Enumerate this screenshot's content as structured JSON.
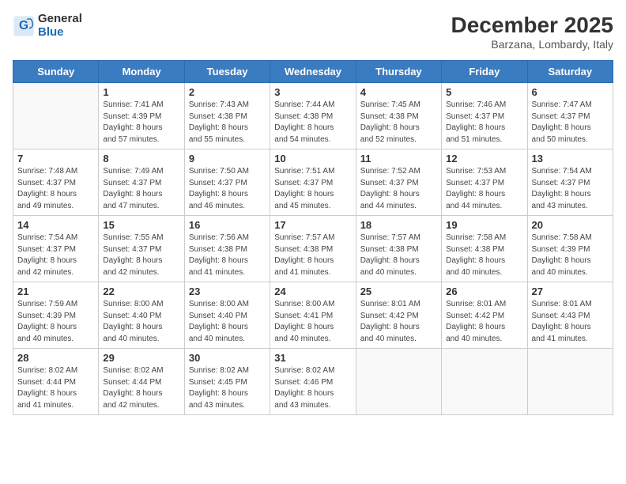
{
  "header": {
    "logo_general": "General",
    "logo_blue": "Blue",
    "month_title": "December 2025",
    "location": "Barzana, Lombardy, Italy"
  },
  "days_of_week": [
    "Sunday",
    "Monday",
    "Tuesday",
    "Wednesday",
    "Thursday",
    "Friday",
    "Saturday"
  ],
  "weeks": [
    [
      {
        "day": "",
        "info": ""
      },
      {
        "day": "1",
        "info": "Sunrise: 7:41 AM\nSunset: 4:39 PM\nDaylight: 8 hours\nand 57 minutes."
      },
      {
        "day": "2",
        "info": "Sunrise: 7:43 AM\nSunset: 4:38 PM\nDaylight: 8 hours\nand 55 minutes."
      },
      {
        "day": "3",
        "info": "Sunrise: 7:44 AM\nSunset: 4:38 PM\nDaylight: 8 hours\nand 54 minutes."
      },
      {
        "day": "4",
        "info": "Sunrise: 7:45 AM\nSunset: 4:38 PM\nDaylight: 8 hours\nand 52 minutes."
      },
      {
        "day": "5",
        "info": "Sunrise: 7:46 AM\nSunset: 4:37 PM\nDaylight: 8 hours\nand 51 minutes."
      },
      {
        "day": "6",
        "info": "Sunrise: 7:47 AM\nSunset: 4:37 PM\nDaylight: 8 hours\nand 50 minutes."
      }
    ],
    [
      {
        "day": "7",
        "info": "Sunrise: 7:48 AM\nSunset: 4:37 PM\nDaylight: 8 hours\nand 49 minutes."
      },
      {
        "day": "8",
        "info": "Sunrise: 7:49 AM\nSunset: 4:37 PM\nDaylight: 8 hours\nand 47 minutes."
      },
      {
        "day": "9",
        "info": "Sunrise: 7:50 AM\nSunset: 4:37 PM\nDaylight: 8 hours\nand 46 minutes."
      },
      {
        "day": "10",
        "info": "Sunrise: 7:51 AM\nSunset: 4:37 PM\nDaylight: 8 hours\nand 45 minutes."
      },
      {
        "day": "11",
        "info": "Sunrise: 7:52 AM\nSunset: 4:37 PM\nDaylight: 8 hours\nand 44 minutes."
      },
      {
        "day": "12",
        "info": "Sunrise: 7:53 AM\nSunset: 4:37 PM\nDaylight: 8 hours\nand 44 minutes."
      },
      {
        "day": "13",
        "info": "Sunrise: 7:54 AM\nSunset: 4:37 PM\nDaylight: 8 hours\nand 43 minutes."
      }
    ],
    [
      {
        "day": "14",
        "info": "Sunrise: 7:54 AM\nSunset: 4:37 PM\nDaylight: 8 hours\nand 42 minutes."
      },
      {
        "day": "15",
        "info": "Sunrise: 7:55 AM\nSunset: 4:37 PM\nDaylight: 8 hours\nand 42 minutes."
      },
      {
        "day": "16",
        "info": "Sunrise: 7:56 AM\nSunset: 4:38 PM\nDaylight: 8 hours\nand 41 minutes."
      },
      {
        "day": "17",
        "info": "Sunrise: 7:57 AM\nSunset: 4:38 PM\nDaylight: 8 hours\nand 41 minutes."
      },
      {
        "day": "18",
        "info": "Sunrise: 7:57 AM\nSunset: 4:38 PM\nDaylight: 8 hours\nand 40 minutes."
      },
      {
        "day": "19",
        "info": "Sunrise: 7:58 AM\nSunset: 4:38 PM\nDaylight: 8 hours\nand 40 minutes."
      },
      {
        "day": "20",
        "info": "Sunrise: 7:58 AM\nSunset: 4:39 PM\nDaylight: 8 hours\nand 40 minutes."
      }
    ],
    [
      {
        "day": "21",
        "info": "Sunrise: 7:59 AM\nSunset: 4:39 PM\nDaylight: 8 hours\nand 40 minutes."
      },
      {
        "day": "22",
        "info": "Sunrise: 8:00 AM\nSunset: 4:40 PM\nDaylight: 8 hours\nand 40 minutes."
      },
      {
        "day": "23",
        "info": "Sunrise: 8:00 AM\nSunset: 4:40 PM\nDaylight: 8 hours\nand 40 minutes."
      },
      {
        "day": "24",
        "info": "Sunrise: 8:00 AM\nSunset: 4:41 PM\nDaylight: 8 hours\nand 40 minutes."
      },
      {
        "day": "25",
        "info": "Sunrise: 8:01 AM\nSunset: 4:42 PM\nDaylight: 8 hours\nand 40 minutes."
      },
      {
        "day": "26",
        "info": "Sunrise: 8:01 AM\nSunset: 4:42 PM\nDaylight: 8 hours\nand 40 minutes."
      },
      {
        "day": "27",
        "info": "Sunrise: 8:01 AM\nSunset: 4:43 PM\nDaylight: 8 hours\nand 41 minutes."
      }
    ],
    [
      {
        "day": "28",
        "info": "Sunrise: 8:02 AM\nSunset: 4:44 PM\nDaylight: 8 hours\nand 41 minutes."
      },
      {
        "day": "29",
        "info": "Sunrise: 8:02 AM\nSunset: 4:44 PM\nDaylight: 8 hours\nand 42 minutes."
      },
      {
        "day": "30",
        "info": "Sunrise: 8:02 AM\nSunset: 4:45 PM\nDaylight: 8 hours\nand 43 minutes."
      },
      {
        "day": "31",
        "info": "Sunrise: 8:02 AM\nSunset: 4:46 PM\nDaylight: 8 hours\nand 43 minutes."
      },
      {
        "day": "",
        "info": ""
      },
      {
        "day": "",
        "info": ""
      },
      {
        "day": "",
        "info": ""
      }
    ]
  ]
}
